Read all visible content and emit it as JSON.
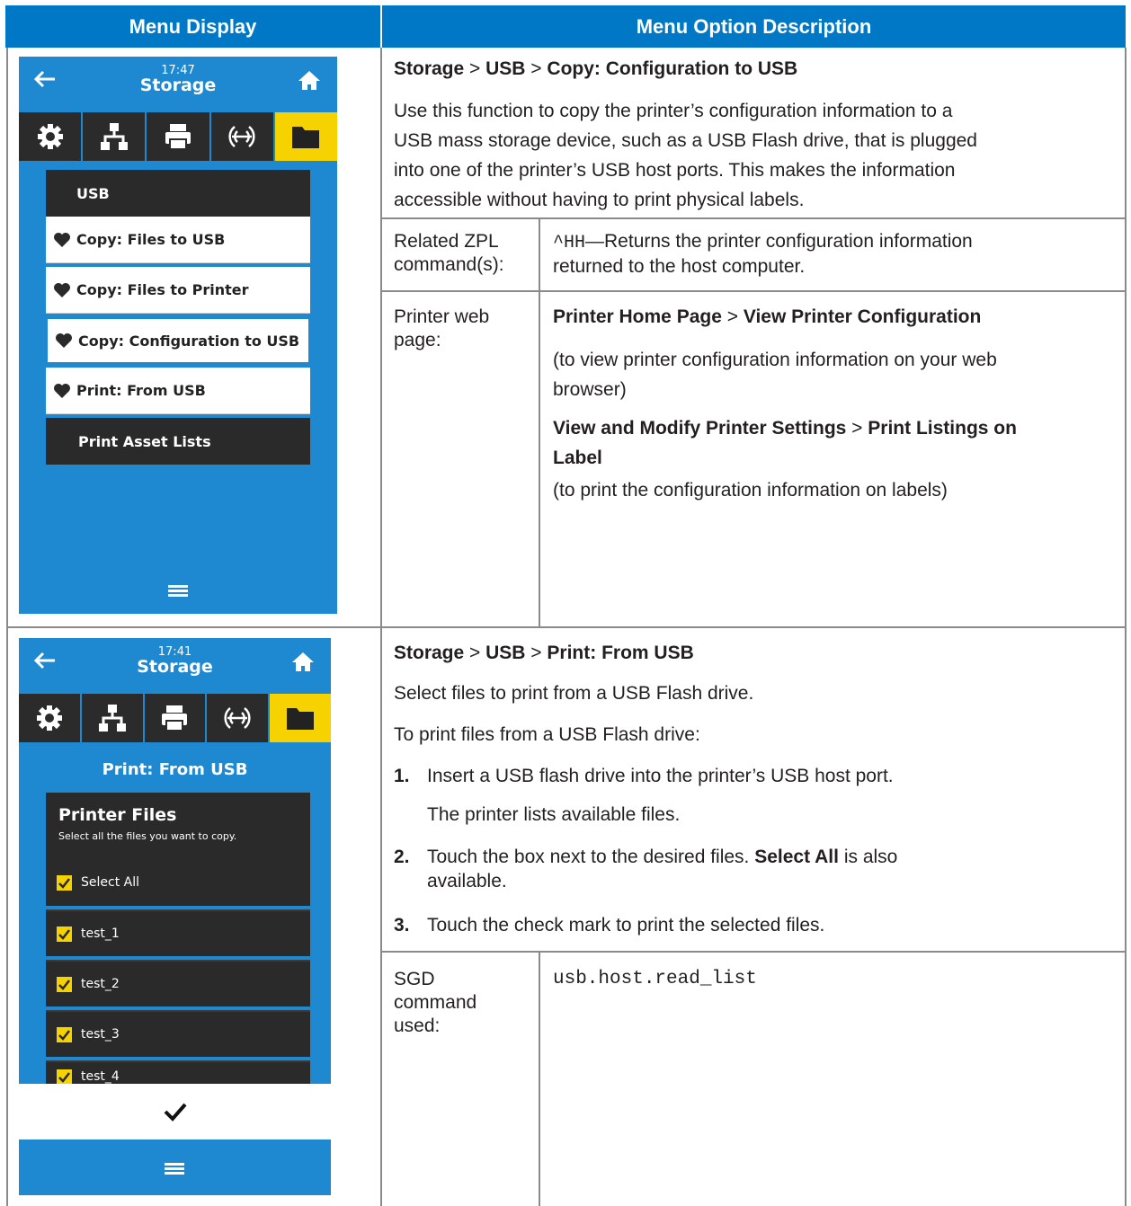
{
  "headers": {
    "col1": "Menu Display",
    "col2": "Menu Option Description"
  },
  "row1": {
    "device": {
      "time": "17:47",
      "title": "Storage",
      "tab_icons": [
        "gear-icon",
        "network-icon",
        "printer-icon",
        "rfid-icon",
        "folder-icon"
      ],
      "menu_header": "USB",
      "items": [
        "Copy: Files to USB",
        "Copy: Files to Printer",
        "Copy: Configuration to USB",
        "Print: From USB"
      ],
      "selected_item": "Copy: Configuration to USB",
      "extra_item": "Print Asset Lists"
    },
    "path": {
      "p1": "Storage",
      "sep1": " > ",
      "p2": "USB",
      "sep2": " > ",
      "p3": "Copy: Configuration to USB"
    },
    "description": [
      "Use this function to copy the printer’s configuration information to a",
      "USB mass storage device, such as a USB Flash drive, that is plugged",
      "into one of the printer’s USB host ports. This makes the information",
      "accessible without having to print physical labels."
    ],
    "zpl_label": [
      "Related ZPL",
      "command(s):"
    ],
    "zpl_code": "^HH",
    "zpl_text": [
      "—Returns the printer configuration information",
      "returned to the host computer."
    ],
    "web_label": [
      "Printer web",
      "page:"
    ],
    "web_path1": {
      "a": "Printer Home Page",
      "sep": " > ",
      "b": "View Printer Configuration"
    },
    "web_note1": [
      "(to view printer configuration information on your web",
      "browser)"
    ],
    "web_path2": {
      "a": "View and Modify Printer Settings",
      "sep": " > ",
      "b1": "Print Listings on",
      "b2": "Label"
    },
    "web_note2": "(to print the configuration information on labels)"
  },
  "row2": {
    "device": {
      "time": "17:41",
      "title": "Storage",
      "page_title": "Print: From USB",
      "dialog_title": "Printer Files",
      "dialog_sub": "Select all the files you want to copy.",
      "select_all": "Select All",
      "files": [
        "test_1",
        "test_2",
        "test_3",
        "test_4"
      ],
      "confirm_icon": "checkmark-icon"
    },
    "path": {
      "p1": "Storage",
      "sep1": " > ",
      "p2": "USB",
      "sep2": " > ",
      "p3": "Print: From USB"
    },
    "intro1": "Select files to print from a USB Flash drive.",
    "intro2": "To print files from a USB Flash drive:",
    "steps": [
      {
        "num": "1.",
        "text": "Insert a USB flash drive into the printer’s USB host port.",
        "sub": "The printer lists available files."
      },
      {
        "num": "2.",
        "text_a": "Touch the box next to the desired files. ",
        "bold": "Select All",
        "text_b": " is also",
        "text_c": "available."
      },
      {
        "num": "3.",
        "text": "Touch the check mark to print the selected files."
      }
    ],
    "sgd_label": [
      "SGD",
      "command",
      "used:"
    ],
    "sgd_value": "usb.host.read_list"
  },
  "colors": {
    "header_blue": "#0078c6",
    "screen_blue": "#1e88d0",
    "accent_yellow": "#f6d300",
    "dark": "#2a2a2a"
  }
}
